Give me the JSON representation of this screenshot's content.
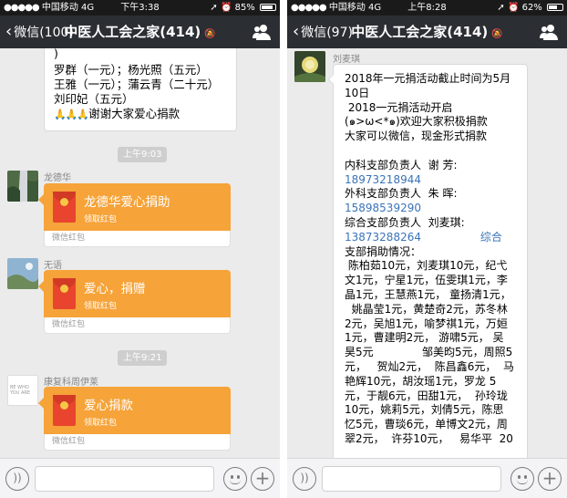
{
  "left": {
    "status": {
      "carrier": "中国移动",
      "network": "4G",
      "time": "下午3:38",
      "battery": "85%",
      "battery_level": 0.85
    },
    "nav": {
      "back_label": "微信(100)",
      "title": "中医人工会之家(414)"
    },
    "top_message_lines": [
      ")",
      "罗群（一元）；杨光照（五元）",
      "王雅（一元）；蒲云青（二十元）",
      "刘印妃（五元）",
      "谢谢大家爱心捐款"
    ],
    "hands_icons": "🙏🙏🙏",
    "time1": "上午9:03",
    "msg1": {
      "sender": "龙德华",
      "title": "龙德华爱心捐助",
      "sub": "领取红包",
      "footer": "微信红包"
    },
    "msg2": {
      "sender": "无语",
      "title": "爱心，捐赠",
      "sub": "领取红包",
      "footer": "微信红包"
    },
    "time2": "上午9:21",
    "msg3": {
      "sender": "康复科周伊莱",
      "avatar_text": "BE WHO YOU ARE",
      "title": "爱心捐款",
      "sub": "领取红包",
      "footer": "微信红包"
    }
  },
  "right": {
    "status": {
      "carrier": "中国移动",
      "network": "4G",
      "time": "上午8:28",
      "battery": "62%",
      "battery_level": 0.62
    },
    "nav": {
      "back_label": "微信(97)",
      "title": "中医人工会之家(414)"
    },
    "sender": "刘麦琪",
    "lines": [
      "2018年一元捐活动截止时间为5月",
      "10日",
      " 2018一元捐活动开启",
      "(๑>ω<*๑)欢迎大家积极捐款",
      "大家可以微信，现金形式捐款",
      "",
      "内科支部负责人  谢 芳:",
      "18973218944",
      "外科支部负责人  朱 晖:",
      "15898539290",
      "综合支部负责人  刘麦琪:",
      "13873288264                 综合",
      "支部捐助情况：",
      " 陈柏茹10元，刘麦琪10元，纪弋",
      "文1元，宁星1元，伍雯琪1元，李",
      "晶1元，王慧燕1元， 童扬清1元，",
      "  姚晶莹1元，黄楚奇2元，苏冬林",
      "2元，吴旭1元，喻梦祺1元，万姮",
      "1元，曹建明2元， 游啸5元， 吴",
      "昊5元              邹美昀5元，周照5",
      "元，   贺灿2元，  陈昌鑫6元，  马",
      "艳辉10元，胡汝瑶1元，罗龙 5",
      "元，于靓6元，田甜1元，  孙玲珑",
      "10元，姚莉5元，刘倩5元，陈思",
      "忆5元，曹琰6元，单博文2元，周",
      "翠2元，  许芬10元，   易华平  20"
    ],
    "link_lines": [
      7,
      9,
      11
    ]
  }
}
